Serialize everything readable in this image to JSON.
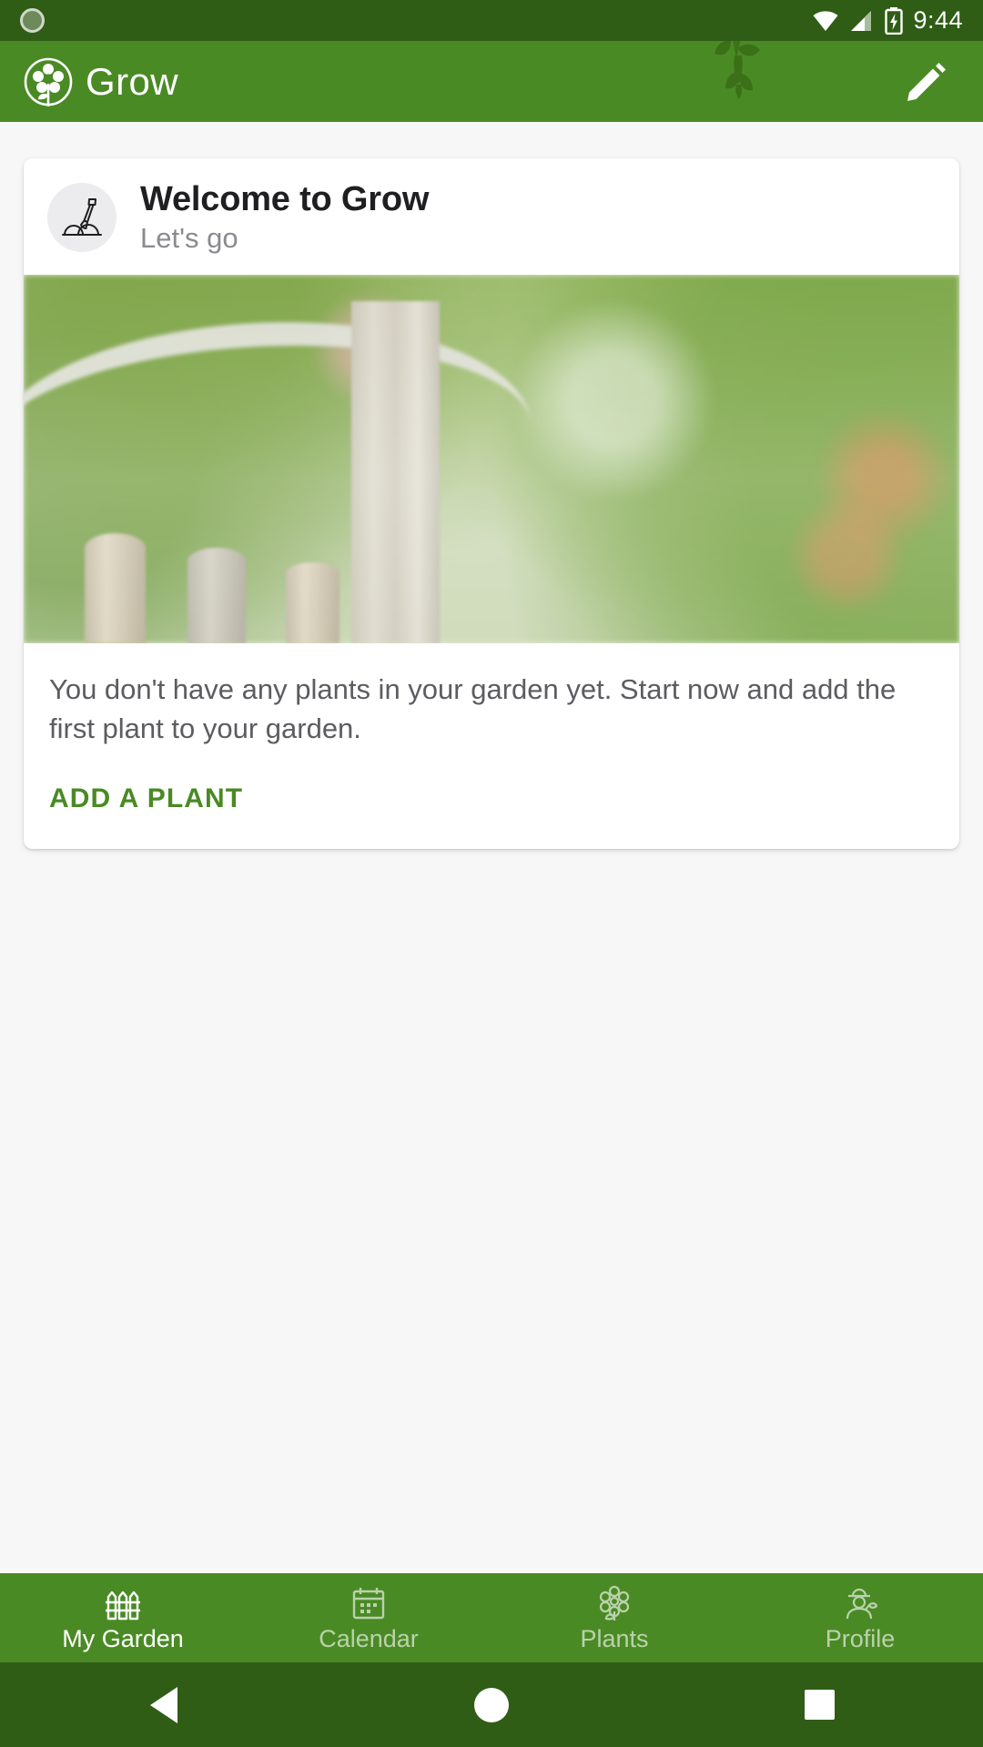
{
  "status_bar": {
    "time": "9:44",
    "icons": [
      "record-dot-icon",
      "wifi-icon",
      "cell-signal-icon",
      "battery-charging-icon"
    ]
  },
  "app_bar": {
    "title": "Grow",
    "logo_icon": "flower-in-circle-logo",
    "decoration_icon": "hanging-leaf-branch-icon",
    "action_icon": "pencil-edit-icon",
    "background_color": "#4a8a24"
  },
  "card": {
    "avatar_icon": "shovel-in-dirt-icon",
    "title": "Welcome to Grow",
    "subtitle": "Let's go",
    "hero_image_alt": "garden-fence-photo",
    "body_text": "You don't have any plants in your garden yet. Start now and add the first plant to your garden.",
    "action_label": "ADD A PLANT",
    "action_color": "#4a8a24"
  },
  "bottom_nav": {
    "items": [
      {
        "label": "My Garden",
        "icon": "fence-icon",
        "active": true
      },
      {
        "label": "Calendar",
        "icon": "calendar-icon",
        "active": false
      },
      {
        "label": "Plants",
        "icon": "flower-icon",
        "active": false
      },
      {
        "label": "Profile",
        "icon": "gardener-person-icon",
        "active": false
      }
    ]
  },
  "system_nav": {
    "back": "back-triangle-icon",
    "home": "home-circle-icon",
    "recents": "recents-square-icon"
  }
}
